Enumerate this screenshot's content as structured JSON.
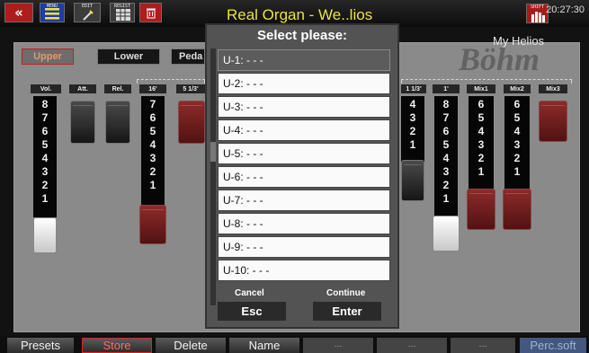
{
  "topbar": {
    "title": "Real Organ - We..lios",
    "clock": "20:27:30",
    "subtitle": "My Helios",
    "watermark": "Böhm",
    "back_icon": "double-chevron-left-icon",
    "menu_label": "MENU",
    "edit_label": "EDIT",
    "regs_label": "REGIST",
    "shift_label": "SHIFT"
  },
  "manual_tabs": [
    "Upper",
    "Lower",
    "Peda"
  ],
  "drawbars": {
    "labels": [
      "Vol.",
      "Att.",
      "Rel.",
      "16'",
      "5 1/3'",
      "1 1/3'",
      "1'",
      "Mix1",
      "Mix2",
      "Mix3"
    ],
    "column_numbers": {
      "vol": [
        "8",
        "7",
        "6",
        "5",
        "4",
        "3",
        "2",
        "1"
      ],
      "b16": [
        "7",
        "6",
        "5",
        "4",
        "3",
        "2",
        "1"
      ],
      "b113": [
        "4",
        "3",
        "2",
        "1"
      ],
      "b1": [
        "8",
        "7",
        "6",
        "5",
        "4",
        "3",
        "2",
        "1"
      ],
      "mix1": [
        "6",
        "5",
        "4",
        "3",
        "2",
        "1"
      ],
      "mix2": [
        "6",
        "5",
        "4",
        "3",
        "2",
        "1"
      ]
    }
  },
  "dialog": {
    "title": "Select please:",
    "items": [
      "U-1: - - -",
      "U-2: - - -",
      "U-3: - - -",
      "U-4: - - -",
      "U-5: - - -",
      "U-6: - - -",
      "U-7: - - -",
      "U-8: - - -",
      "U-9: - - -",
      "U-10: - - -"
    ],
    "selected_index": 0,
    "cancel_label": "Cancel",
    "esc_label": "Esc",
    "continue_label": "Continue",
    "enter_label": "Enter"
  },
  "softkeys": [
    "Presets",
    "Store",
    "Delete",
    "Name",
    "---",
    "---",
    "---",
    "Perc.soft"
  ],
  "colors": {
    "accent_red": "#b01c1c",
    "title_yellow": "#e9e43a",
    "drawbar_red": "#7a1f1f"
  }
}
